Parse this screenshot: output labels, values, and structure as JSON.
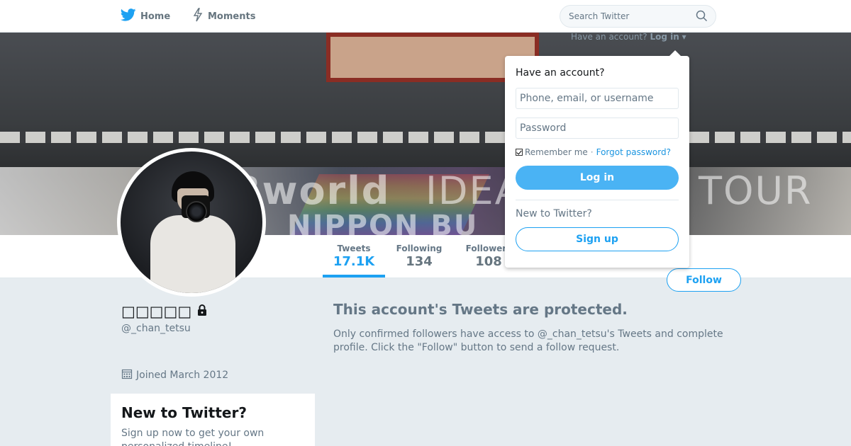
{
  "nav": {
    "home_label": "Home",
    "moments_label": "Moments",
    "search_placeholder": "Search Twitter"
  },
  "login_toggle": {
    "prefix": "Have an account?",
    "action": "Log in"
  },
  "login_dropdown": {
    "heading": "Have an account?",
    "username_placeholder": "Phone, email, or username",
    "password_placeholder": "Password",
    "remember_label": "Remember me",
    "separator": "·",
    "forgot_label": "Forgot password?",
    "remember_checked": true,
    "login_button": "Log in",
    "new_heading": "New to Twitter?",
    "signup_button": "Sign up"
  },
  "stats": {
    "tweets": {
      "label": "Tweets",
      "value": "17.1K"
    },
    "following": {
      "label": "Following",
      "value": "134"
    },
    "followers": {
      "label": "Followers",
      "value": "108"
    }
  },
  "follow_button": "Follow",
  "profile": {
    "fullname": "□□□□□",
    "screen_name": "@_chan_tetsu",
    "joined": "Joined March 2012"
  },
  "protected": {
    "title": "This account's Tweets are protected.",
    "body": "Only confirmed followers have access to @_chan_tetsu's Tweets and complete profile. Click the \"Follow\" button to send a follow request."
  },
  "signup_card": {
    "title": "New to Twitter?",
    "text": "Sign up now to get your own personalized timeline!"
  },
  "banner_text": {
    "left": "3world",
    "mid": "IDEA",
    "bottom": "NIPPON BU",
    "right": "TOUR"
  },
  "colors": {
    "accent": "#1da1f2",
    "login_button_bg": "#4ab3f4",
    "page_bg": "#e6ecf0",
    "muted_text": "#657786"
  }
}
